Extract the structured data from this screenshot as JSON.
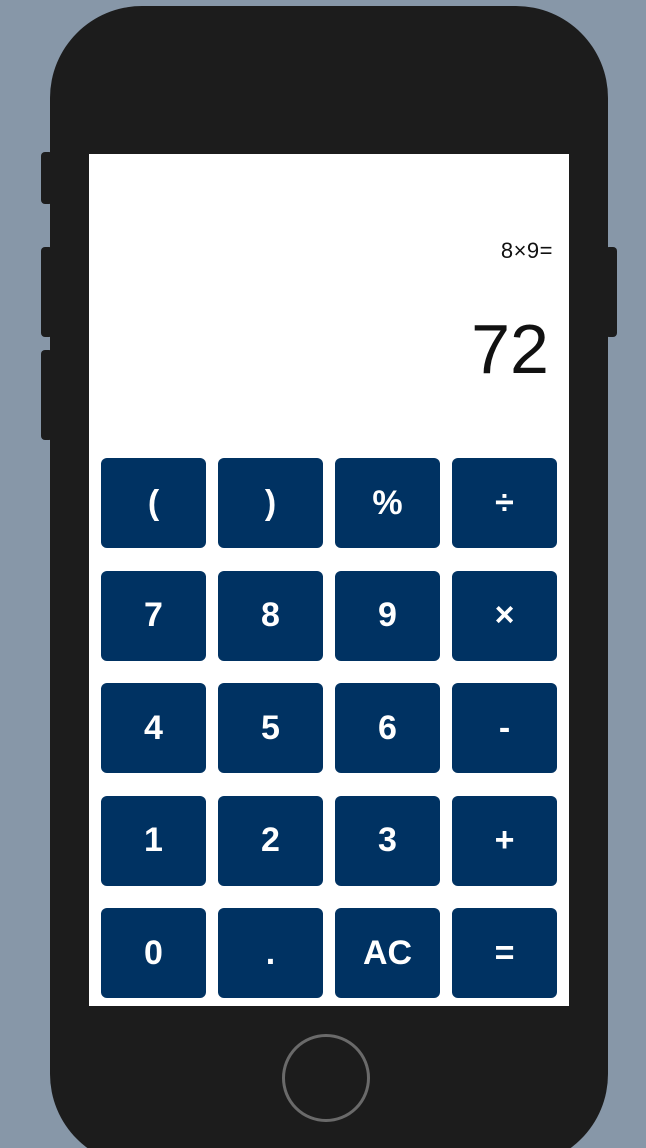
{
  "display": {
    "expression": "8×9=",
    "result": "72"
  },
  "keys": [
    {
      "label": "(",
      "name": "open-paren-key"
    },
    {
      "label": ")",
      "name": "close-paren-key"
    },
    {
      "label": "%",
      "name": "percent-key"
    },
    {
      "label": "÷",
      "name": "divide-key"
    },
    {
      "label": "7",
      "name": "digit-7-key"
    },
    {
      "label": "8",
      "name": "digit-8-key"
    },
    {
      "label": "9",
      "name": "digit-9-key"
    },
    {
      "label": "×",
      "name": "multiply-key"
    },
    {
      "label": "4",
      "name": "digit-4-key"
    },
    {
      "label": "5",
      "name": "digit-5-key"
    },
    {
      "label": "6",
      "name": "digit-6-key"
    },
    {
      "label": "-",
      "name": "subtract-key"
    },
    {
      "label": "1",
      "name": "digit-1-key"
    },
    {
      "label": "2",
      "name": "digit-2-key"
    },
    {
      "label": "3",
      "name": "digit-3-key"
    },
    {
      "label": "+",
      "name": "add-key"
    },
    {
      "label": "0",
      "name": "digit-0-key"
    },
    {
      "label": ".",
      "name": "decimal-key"
    },
    {
      "label": "AC",
      "name": "all-clear-key"
    },
    {
      "label": "=",
      "name": "equals-key"
    }
  ],
  "colors": {
    "key_background": "#003262",
    "key_text": "#ffffff",
    "screen_background": "#ffffff",
    "device_frame": "#1c1c1c",
    "page_background": "#8797a8"
  }
}
